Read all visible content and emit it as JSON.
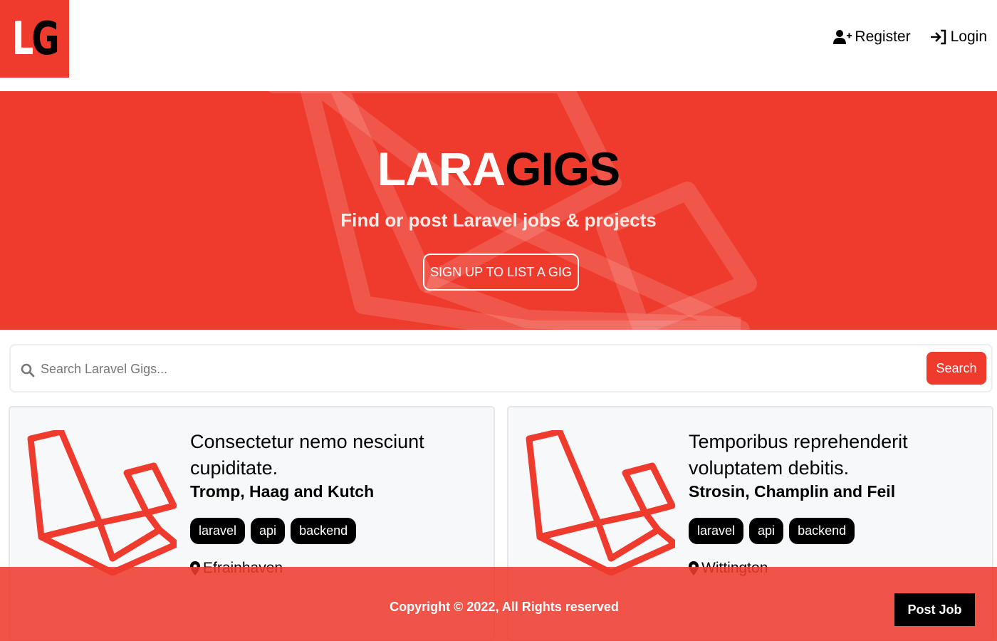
{
  "brand": {
    "logo_l": "L",
    "logo_g": "G",
    "color": "#ef3b2d"
  },
  "nav": {
    "items": [
      {
        "label": "Register",
        "icon": "user-plus-icon"
      },
      {
        "label": "Login",
        "icon": "sign-in-icon"
      }
    ]
  },
  "hero": {
    "title_light": "LARA",
    "title_dark": "GIGS",
    "subtitle": "Find or post Laravel jobs & projects",
    "cta_label": "SIGN UP TO LIST A GIG"
  },
  "search": {
    "placeholder": "Search Laravel Gigs...",
    "value": "",
    "button_label": "Search",
    "icon": "search-icon"
  },
  "listings": [
    {
      "title": "Consectetur nemo nesciunt cupiditate.",
      "company": "Tromp, Haag and Kutch",
      "tags": [
        "laravel",
        "api",
        "backend"
      ],
      "location": "Efrainhaven",
      "logo_icon": "laravel-logo-icon"
    },
    {
      "title": "Temporibus reprehenderit voluptatem debitis.",
      "company": "Strosin, Champlin and Feil",
      "tags": [
        "laravel",
        "api",
        "backend"
      ],
      "location": "Wittington",
      "logo_icon": "laravel-logo-icon"
    }
  ],
  "footer": {
    "copyright": "Copyright © 2022, All Rights reserved",
    "post_job_label": "Post Job"
  }
}
